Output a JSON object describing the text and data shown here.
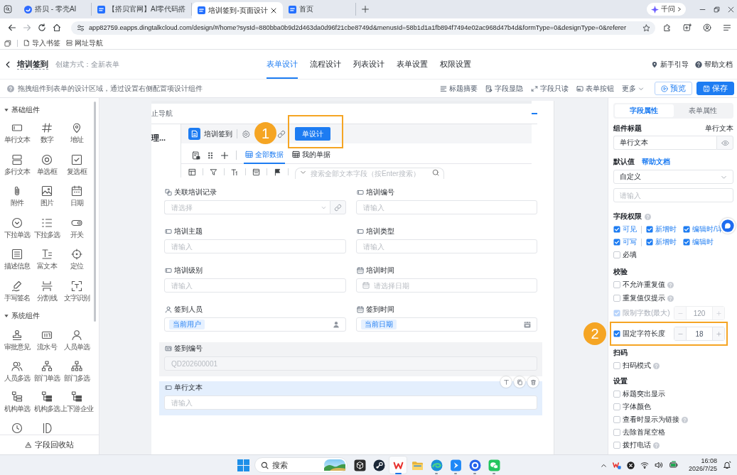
{
  "browser": {
    "tabs": [
      {
        "title": "搭贝 - 零壳AI",
        "selected": false
      },
      {
        "title": "【搭贝官网】AI零代码搭",
        "selected": false
      },
      {
        "title": "培训签到-页面设计",
        "selected": true
      },
      {
        "title": "首页",
        "selected": false
      }
    ],
    "assistant_button": "千问",
    "url": "app82759.eapps.dingtalkcloud.com/design/#/home?sysId=880bba0b9d2d463da0d96f21cbe8749d&menusId=58b1d1a1fb894f7494e02ac968d47b4d&formType=0&designType=0&referer",
    "bookmarks": [
      "导入书签",
      "网址导航"
    ]
  },
  "app_header": {
    "title": "培训签到",
    "creation_mode": "创建方式：全新表单",
    "tabs": [
      {
        "label": "表单设计",
        "selected": true
      },
      {
        "label": "流程设计",
        "selected": false
      },
      {
        "label": "列表设计",
        "selected": false
      },
      {
        "label": "表单设置",
        "selected": false
      },
      {
        "label": "权限设置",
        "selected": false
      }
    ],
    "links": [
      "新手引导",
      "帮助文档"
    ]
  },
  "toolbar": {
    "hint": "拖拽组件到表单的设计区域，通过设置右侧配置项设计组件",
    "actions": [
      "标题摘要",
      "字段显隐",
      "字段只读",
      "表单按钮"
    ],
    "more": "更多",
    "preview_button": "预览",
    "save_button": "保存"
  },
  "component_panel": {
    "groups": [
      {
        "title": "基础组件",
        "expanded": true,
        "items": [
          {
            "kind": "full",
            "label": "单行文本"
          },
          {
            "kind": "full",
            "label": "数字"
          },
          {
            "kind": "full",
            "label": "地址"
          },
          {
            "kind": "full",
            "label": "多行文本"
          },
          {
            "kind": "full",
            "label": "单选框"
          },
          {
            "kind": "full",
            "label": "复选框"
          },
          {
            "kind": "full",
            "label": "附件"
          },
          {
            "kind": "full",
            "label": "图片"
          },
          {
            "kind": "full",
            "label": "日期"
          },
          {
            "kind": "full",
            "label": "下拉单选"
          },
          {
            "kind": "full",
            "label": "下拉多选"
          },
          {
            "kind": "full",
            "label": "开关"
          },
          {
            "kind": "full",
            "label": "描述信息"
          },
          {
            "kind": "full",
            "label": "富文本"
          },
          {
            "kind": "full",
            "label": "定位"
          },
          {
            "kind": "full",
            "label": "手写签名"
          },
          {
            "kind": "full",
            "label": "分割线"
          },
          {
            "kind": "full",
            "label": "文字识别"
          }
        ]
      },
      {
        "title": "系统组件",
        "expanded": true,
        "items": [
          {
            "kind": "full",
            "label": "审批意见"
          },
          {
            "kind": "full",
            "label": "流水号"
          },
          {
            "kind": "full",
            "label": "人员单选"
          },
          {
            "kind": "full",
            "label": "人员多选"
          },
          {
            "kind": "full",
            "label": "部门单选"
          },
          {
            "kind": "full",
            "label": "部门多选"
          },
          {
            "kind": "full",
            "label": "机构单选"
          },
          {
            "kind": "full",
            "label": "机构多选"
          },
          {
            "kind": "full",
            "label": "上下游企业"
          },
          {
            "kind": "cut"
          },
          {
            "kind": "cut"
          }
        ]
      }
    ],
    "recycle_bin": "字段回收站"
  },
  "canvas": {
    "nav_text": "止导航",
    "preview_snippet": {
      "side_text": "理...",
      "app_name": "培训签到",
      "design_button": {
        "label": "单设计",
        "callout": "1"
      },
      "tabs": [
        {
          "label": "全部数据",
          "selected": true
        },
        {
          "label": "我的单据",
          "selected": false
        }
      ],
      "search_placeholder": "搜索全部文本字段（按Enter搜索）"
    },
    "form_rows": [
      [
        {
          "kind": "association",
          "label": "关联培训记录",
          "placeholder": "请选择",
          "selected": false
        },
        {
          "kind": "text",
          "label": "培训编号",
          "placeholder": "请输入",
          "selected": false
        }
      ],
      [
        {
          "kind": "text",
          "label": "培训主题",
          "placeholder": "请输入",
          "selected": false
        },
        {
          "kind": "text",
          "label": "培训类型",
          "placeholder": "请输入",
          "selected": false
        }
      ],
      [
        {
          "kind": "text",
          "label": "培训级别",
          "placeholder": "请输入",
          "selected": false
        },
        {
          "kind": "date",
          "label": "培训时间",
          "placeholder": "请选择日期",
          "selected": false
        }
      ],
      [
        {
          "kind": "user",
          "label": "签到人员",
          "value": "当前用户",
          "selected": false
        },
        {
          "kind": "datetime",
          "label": "签到时间",
          "value": "当前日期",
          "selected": false
        }
      ],
      [
        {
          "kind": "serial",
          "label": "签到编号",
          "placeholder": "QD202600001",
          "selected": false
        }
      ],
      [
        {
          "kind": "text",
          "label": "单行文本",
          "placeholder": "请输入",
          "selected": true
        }
      ]
    ]
  },
  "properties_panel": {
    "tabs": [
      {
        "label": "字段属性",
        "selected": true
      },
      {
        "label": "表单属性",
        "selected": false
      }
    ],
    "component_title": {
      "label": "组件标题",
      "type": "单行文本",
      "value": "单行文本"
    },
    "default_value": {
      "label": "默认值",
      "help_link": "帮助文档",
      "mode": "自定义",
      "placeholder": "请输入"
    },
    "permissions": {
      "label": "字段权限",
      "groups": [
        {
          "label": "可见",
          "checked": true,
          "options": [
            {
              "label": "新增时",
              "checked": true
            },
            {
              "label": "编辑时/详",
              "checked": true
            }
          ]
        },
        {
          "label": "可写",
          "checked": true,
          "options": [
            {
              "label": "新增时",
              "checked": true
            },
            {
              "label": "编辑时",
              "checked": true
            }
          ]
        }
      ],
      "required": {
        "label": "必填",
        "checked": false
      }
    },
    "sections": [
      {
        "title": "校验",
        "items": [
          {
            "kind": "checkbox",
            "label": "不允许重复值",
            "checked": false,
            "disabled": false,
            "help": true
          },
          {
            "kind": "checkbox",
            "label": "重复值仅提示",
            "checked": false,
            "disabled": false,
            "help": true
          },
          {
            "kind": "stepper",
            "label": "限制字数(最大)",
            "checked": true,
            "disabled": true,
            "help": false,
            "value": "120"
          },
          {
            "kind": "stepper",
            "label": "固定字符长度",
            "checked": true,
            "disabled": false,
            "help": false,
            "value": "18",
            "callout": "2"
          }
        ]
      },
      {
        "title": "扫码",
        "items": [
          {
            "kind": "checkbox",
            "label": "扫码模式",
            "checked": false,
            "disabled": false,
            "help": true
          }
        ]
      },
      {
        "title": "设置",
        "items": [
          {
            "kind": "checkbox",
            "label": "标题突出显示",
            "checked": false,
            "disabled": false,
            "help": false
          },
          {
            "kind": "checkbox",
            "label": "字体颜色",
            "checked": false,
            "disabled": false,
            "help": false
          },
          {
            "kind": "checkbox",
            "label": "查看时显示为链接",
            "checked": false,
            "disabled": false,
            "help": true
          },
          {
            "kind": "checkbox",
            "label": "去除首尾空格",
            "checked": false,
            "disabled": false,
            "help": false
          },
          {
            "kind": "checkbox",
            "label": "拨打电话",
            "checked": false,
            "disabled": false,
            "help": true
          }
        ]
      }
    ]
  },
  "taskbar": {
    "search_placeholder": "搜索",
    "apps": [
      {
        "active": false,
        "running": false
      },
      {
        "active": false,
        "running": false
      },
      {
        "active": true,
        "running": true
      },
      {
        "active": false,
        "running": false
      },
      {
        "active": false,
        "running": true
      },
      {
        "active": false,
        "running": true
      },
      {
        "active": false,
        "running": true
      },
      {
        "active": false,
        "running": true
      }
    ],
    "time": "16:08",
    "date": "2026/7/25"
  }
}
